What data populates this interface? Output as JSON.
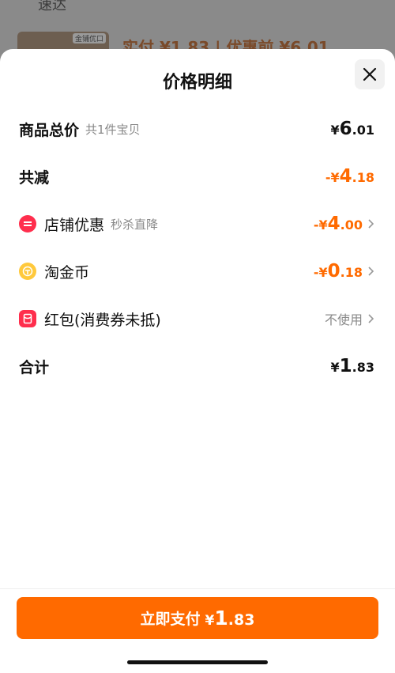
{
  "background": {
    "top_text": "速达",
    "thumb_badge": "金铺优口",
    "price_line": "实付 ¥1.83 | 优惠前 ¥6.01"
  },
  "sheet": {
    "title": "价格明细",
    "close_icon": "close-icon"
  },
  "rows": {
    "total": {
      "label": "商品总价",
      "sub": "共1件宝贝",
      "currency": "¥",
      "int": "6",
      "dec": ".01"
    },
    "reduce": {
      "label": "共减",
      "currency": "-¥",
      "int": "4",
      "dec": ".18"
    },
    "shop": {
      "label": "店铺优惠",
      "sub": "秒杀直降",
      "currency": "-¥",
      "int": "4",
      "dec": ".00",
      "icon": "shop-discount-icon"
    },
    "coin": {
      "label": "淘金币",
      "currency": "-¥",
      "int": "0",
      "dec": ".18",
      "icon": "coin-icon"
    },
    "redpacket": {
      "label": "红包(消费券未抵)",
      "value": "不使用",
      "icon": "red-packet-icon"
    },
    "sum": {
      "label": "合计",
      "currency": "¥",
      "int": "1",
      "dec": ".83"
    }
  },
  "pay_button": {
    "label": "立即支付",
    "currency": "¥",
    "int": "1",
    "dec": ".83"
  },
  "colors": {
    "accent": "#ff6a00",
    "danger": "#ff2e4d",
    "coin": "#ffc93c"
  }
}
